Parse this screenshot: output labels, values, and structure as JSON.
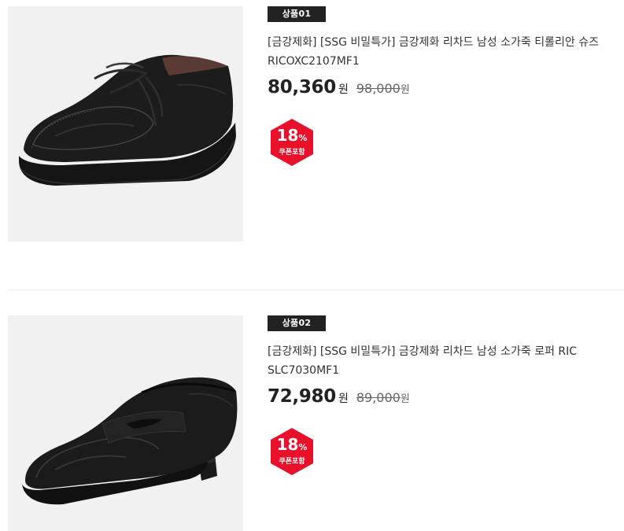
{
  "products": [
    {
      "badge": "상품01",
      "title": "[금강제화] [SSG 비밀특가] 금강제화 리차드 남성 소가죽 티롤리안 슈즈 RICOXC2107MF1",
      "price": "80,360",
      "currency": "원",
      "original_price": "98,000",
      "original_currency": "원",
      "discount_number": "18",
      "discount_symbol": "%",
      "coupon_label": "쿠폰포함",
      "image_icon": "tyrolean-shoe-image"
    },
    {
      "badge": "상품02",
      "title": "[금강제화] [SSG 비밀특가] 금강제화 리차드 남성 소가죽 로퍼 RIC SLC7030MF1",
      "price": "72,980",
      "currency": "원",
      "original_price": "89,000",
      "original_currency": "원",
      "discount_number": "18",
      "discount_symbol": "%",
      "coupon_label": "쿠폰포함",
      "image_icon": "penny-loafer-image"
    }
  ],
  "colors": {
    "badge_bg": "#222222",
    "coupon_red": "#e8102a",
    "thumb_bg": "#f1f1f1"
  }
}
